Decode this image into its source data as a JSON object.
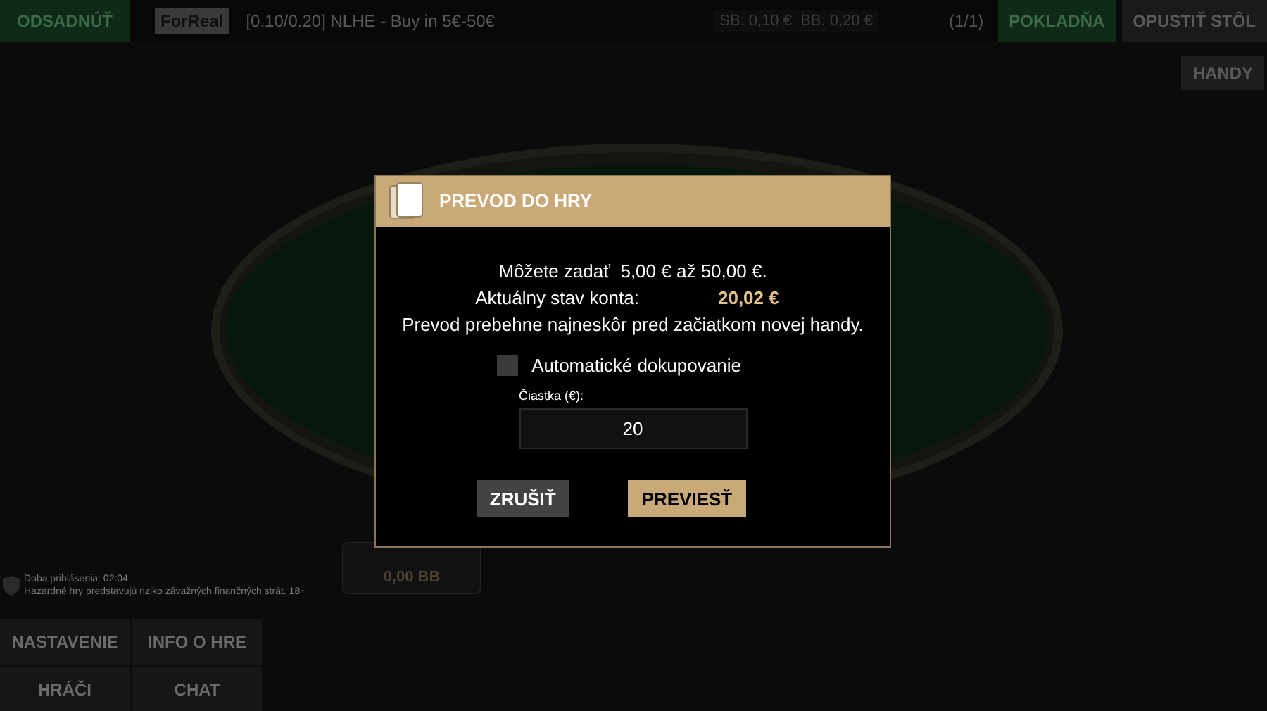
{
  "top_bar": {
    "sit_out_button": "ODSADNÚŤ",
    "mode_badge": "ForReal",
    "table_info": "[0.10/0.20] NLHE - Buy in 5€-50€",
    "blinds": "SB: 0,10 €  BB: 0,20 €",
    "table_count": "(1/1)",
    "cashier_button": "POKLADŇA",
    "leave_button": "OPUSTIŤ STÔL"
  },
  "hands_button": "HANDY",
  "seat": {
    "stack": "0,00 BB"
  },
  "footer_info": {
    "session_time": "Doba prihlásenia: 02:04",
    "warning": "Hazardné hry predstavujú riziko závažných finančných strát. 18+"
  },
  "bottom_menu": [
    {
      "label": "NASTAVENIE"
    },
    {
      "label": "INFO O HRE"
    },
    {
      "label": "HRÁČI"
    },
    {
      "label": "CHAT"
    }
  ],
  "dialog": {
    "title": "PREVOD DO HRY",
    "range_text": "Môžete zadať  5,00 € až 50,00 €.",
    "balance_label": "Aktuálny stav konta:",
    "balance_value": "20,02 €",
    "note": "Prevod prebehne najneskôr pred začiatkom novej handy.",
    "auto_rebuy": {
      "label": "Automatické dokupovanie",
      "checked": false
    },
    "amount_label": "Čiastka (€):",
    "amount_value": "20",
    "cancel_button": "ZRUŠIŤ",
    "confirm_button": "PREVIESŤ"
  }
}
